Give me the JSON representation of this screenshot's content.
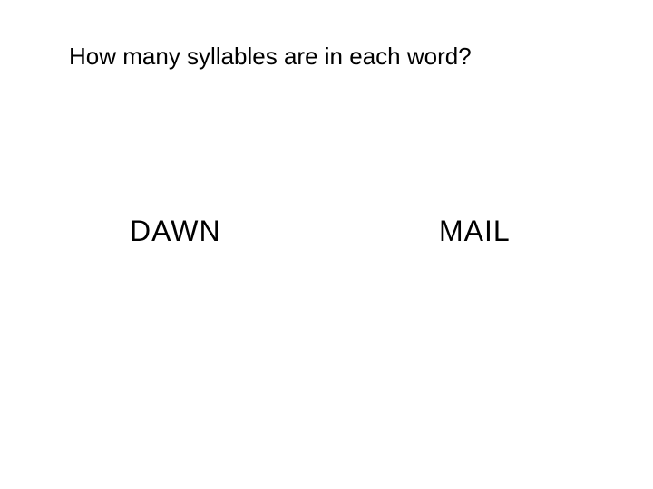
{
  "slide": {
    "title": "How many syllables are in each word?",
    "words": [
      "DAWN",
      "MAIL"
    ]
  }
}
